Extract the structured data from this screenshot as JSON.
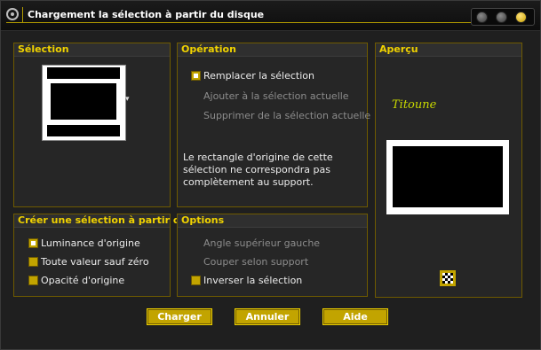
{
  "window": {
    "title": "Chargement la sélection à partir du disque"
  },
  "selection_panel": {
    "title": "Sélection",
    "dropdown_arrow": "▾"
  },
  "operation_panel": {
    "title": "Opération",
    "options": [
      {
        "label": "Remplacer la sélection",
        "checked": true,
        "enabled": true
      },
      {
        "label": "Ajouter à la sélection actuelle",
        "enabled": false
      },
      {
        "label": "Supprimer de la sélection actuelle",
        "enabled": false
      }
    ],
    "message": [
      "Le rectangle d'origine de cette",
      "sélection ne correspondra pas",
      "complètement au support."
    ]
  },
  "preview_panel": {
    "title": "Aperçu",
    "signature": "Titoune",
    "icon": "checkerboard-icon"
  },
  "create_panel": {
    "title": "Créer une sélection à partir de :",
    "options": [
      {
        "label": "Luminance d'origine",
        "checked": true
      },
      {
        "label": "Toute valeur sauf zéro",
        "checked": false
      },
      {
        "label": "Opacité d'origine",
        "checked": false
      }
    ]
  },
  "options_panel": {
    "title": "Options",
    "items": [
      {
        "label": "Angle supérieur gauche",
        "enabled": false
      },
      {
        "label": "Couper selon support",
        "enabled": false
      },
      {
        "label": "Inverser la sélection",
        "checked": false,
        "enabled": true
      }
    ]
  },
  "buttons": {
    "ok": "Charger",
    "cancel": "Annuler",
    "help": "Aide"
  },
  "colors": {
    "accent": "#c2a400",
    "heading": "#f0d200",
    "border": "#6e5a00",
    "background": "#1f1f1f"
  }
}
